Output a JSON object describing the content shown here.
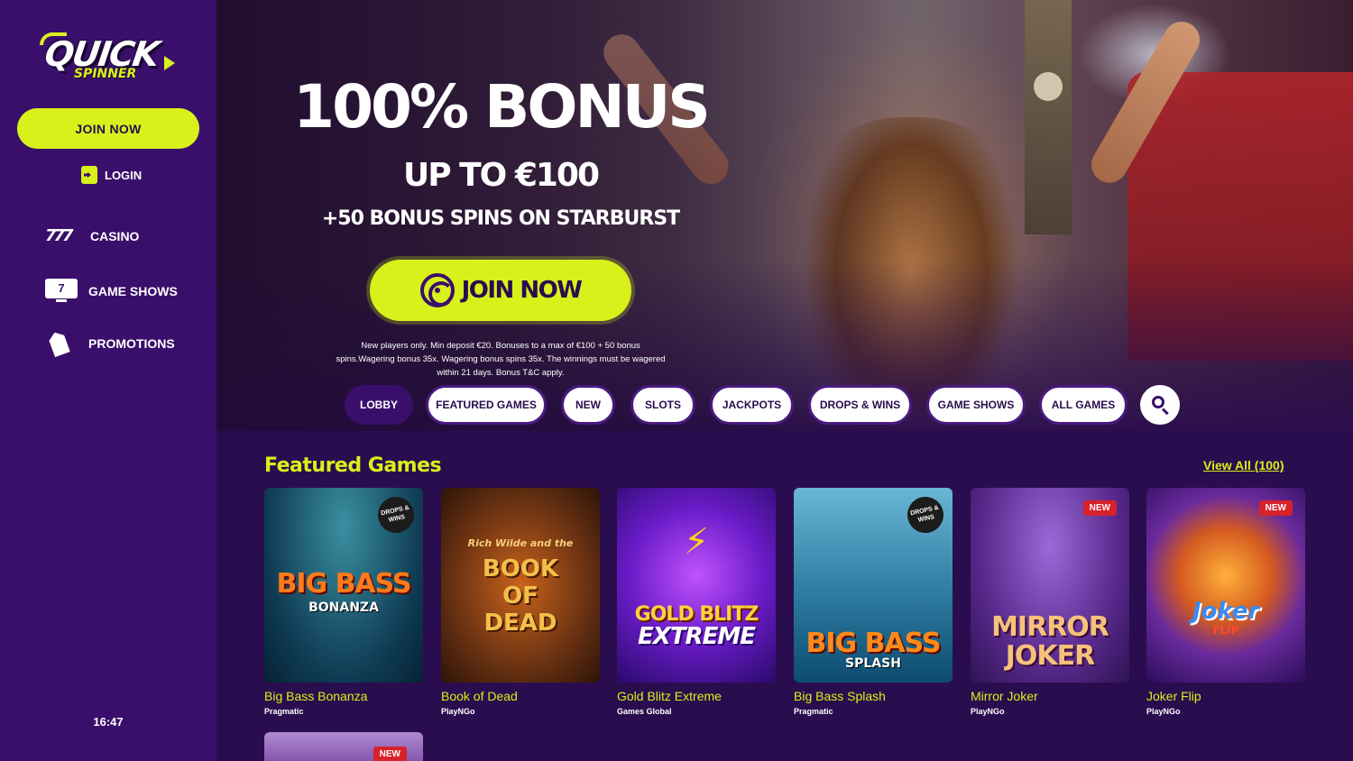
{
  "brand": {
    "logo_main": "QUICK",
    "logo_sub": "SPINNER",
    "accent": "#d8f11a",
    "bg": "#2a0d4e",
    "sidebar_bg": "#3a0f6b"
  },
  "sidebar": {
    "join_label": "JOIN NOW",
    "login_label": "LOGIN",
    "items": [
      {
        "label": "CASINO",
        "icon": "slot-777-icon",
        "icon_text": "777"
      },
      {
        "label": "GAME SHOWS",
        "icon": "tv-icon",
        "icon_text": "7"
      },
      {
        "label": "PROMOTIONS",
        "icon": "tag-icon"
      }
    ],
    "time": "16:47"
  },
  "hero": {
    "title": "100% BONUS",
    "subtitle": "UP TO €100",
    "subtitle2": "+50 BONUS SPINS ON STARBURST",
    "cta": "JOIN NOW",
    "terms": "New players only. Min deposit €20. Bonuses to a max of €100 + 50 bonus spins.Wagering bonus 35x. Wagering bonus spins 35x. The winnings must be wagered within 21 days. Bonus T&C apply."
  },
  "filters": {
    "items": [
      "LOBBY",
      "FEATURED GAMES",
      "NEW",
      "SLOTS",
      "JACKPOTS",
      "DROPS & WINS",
      "GAME SHOWS",
      "ALL GAMES"
    ],
    "active": "LOBBY",
    "search_icon": "search-icon"
  },
  "featured": {
    "title": "Featured Games",
    "view_all": "View All (100)",
    "games": [
      {
        "name": "Big Bass Bonanza",
        "provider": "Pragmatic",
        "art_title": "BIG BASS",
        "art_sub": "BONANZA",
        "badge": "DROPS & WINS"
      },
      {
        "name": "Book of Dead",
        "provider": "PlayNGo",
        "art_title": "BOOK OF DEAD",
        "art_sub": "Rich Wilde and the"
      },
      {
        "name": "Gold Blitz Extreme",
        "provider": "Games Global",
        "art_title": "GOLD BLITZ",
        "art_sub": "EXTREME"
      },
      {
        "name": "Big Bass Splash",
        "provider": "Pragmatic",
        "art_title": "BIG BASS",
        "art_sub": "SPLASH",
        "badge": "DROPS & WINS"
      },
      {
        "name": "Mirror Joker",
        "provider": "PlayNGo",
        "art_title": "MIRROR",
        "art_sub": "JOKER",
        "badge": "NEW"
      },
      {
        "name": "Joker Flip",
        "provider": "PlayNGo",
        "art_title": "Joker",
        "art_sub": "FLIP",
        "badge": "NEW"
      }
    ],
    "next_row_badge": "NEW"
  }
}
